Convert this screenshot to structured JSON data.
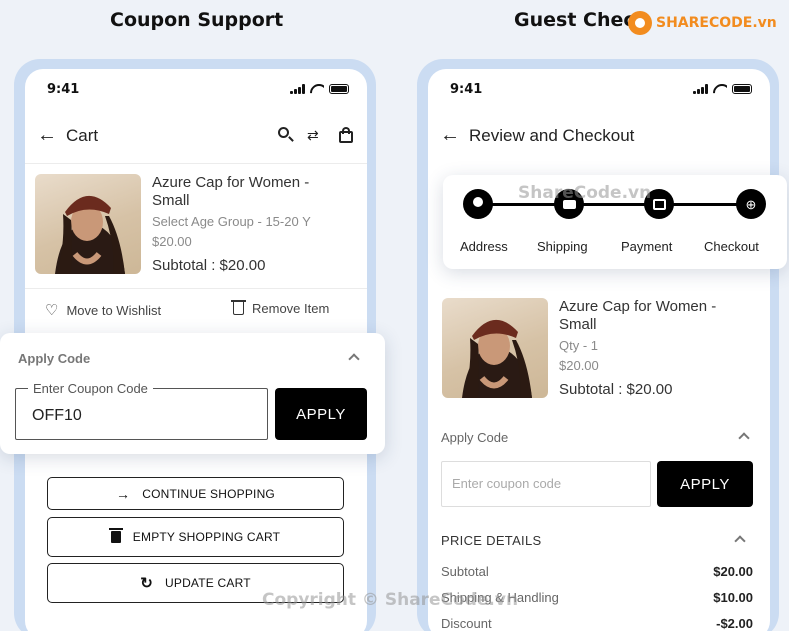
{
  "left": {
    "heading": "Coupon Support",
    "status_time": "9:41",
    "title": "Cart",
    "product": {
      "name": "Azure Cap for Women -",
      "name2": "Small",
      "option": "Select Age Group - 15-20 Y",
      "price": "$20.00",
      "subtotal": "Subtotal : $20.00"
    },
    "wishlist_label": "Move to Wishlist",
    "remove_label": "Remove Item",
    "apply_code": {
      "title": "Apply Code",
      "field_label": "Enter Coupon Code",
      "value": "OFF10",
      "button": "APPLY"
    },
    "buttons": {
      "continue": "CONTINUE SHOPPING",
      "empty": "EMPTY SHOPPING CART",
      "update": "UPDATE CART"
    }
  },
  "right": {
    "heading": "Guest Check",
    "status_time": "9:41",
    "title": "Review and Checkout",
    "steps": [
      "Address",
      "Shipping",
      "Payment",
      "Checkout"
    ],
    "product": {
      "name": "Azure Cap for Women -",
      "name2": "Small",
      "qty": "Qty - 1",
      "price": "$20.00",
      "subtotal": "Subtotal : $20.00"
    },
    "apply_code": {
      "title": "Apply Code",
      "placeholder": "Enter coupon code",
      "button": "APPLY"
    },
    "price_details": {
      "title": "PRICE DETAILS",
      "rows": [
        {
          "label": "Subtotal",
          "value": "$20.00"
        },
        {
          "label": "Shipping & Handling",
          "value": "$10.00"
        },
        {
          "label": "Discount",
          "value": "-$2.00"
        }
      ]
    }
  },
  "watermarks": {
    "logo": "SHARECODE.vn",
    "center": "ShareCode.vn",
    "copyright": "Copyright © ShareCode.vn"
  },
  "colors": {
    "accent": "#000000",
    "frame": "#cbdcf2",
    "background": "#eef2f8"
  }
}
